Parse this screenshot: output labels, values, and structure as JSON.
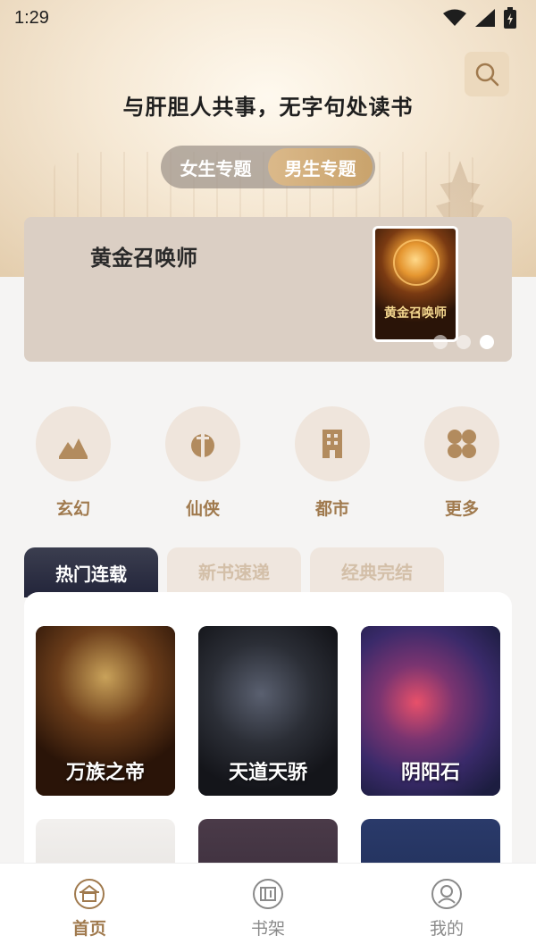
{
  "status_bar": {
    "time": "1:29"
  },
  "header": {
    "slogan": "与肝胆人共事，无字句处读书"
  },
  "gender_tabs": [
    {
      "label": "女生专题",
      "active": false
    },
    {
      "label": "男生专题",
      "active": true
    }
  ],
  "banner": {
    "title": "黄金召唤师",
    "cover_text": "黄金召唤师",
    "dots": 3,
    "active_dot": 3
  },
  "categories": [
    {
      "label": "玄幻",
      "icon": "mountain-icon"
    },
    {
      "label": "仙侠",
      "icon": "sword-icon"
    },
    {
      "label": "都市",
      "icon": "building-icon"
    },
    {
      "label": "更多",
      "icon": "grid-icon"
    }
  ],
  "list_tabs": [
    {
      "label": "热门连载",
      "active": true
    },
    {
      "label": "新书速递",
      "active": false
    },
    {
      "label": "经典完结",
      "active": false
    }
  ],
  "books": [
    {
      "title": "万族之帝"
    },
    {
      "title": "天道天骄"
    },
    {
      "title": "阴阳石"
    },
    {
      "title": ""
    },
    {
      "title": ""
    },
    {
      "title": ""
    }
  ],
  "bottom_nav": [
    {
      "label": "首页",
      "active": true,
      "icon": "home-icon"
    },
    {
      "label": "书架",
      "active": false,
      "icon": "bookshelf-icon"
    },
    {
      "label": "我的",
      "active": false,
      "icon": "profile-icon"
    }
  ],
  "colors": {
    "accent": "#a07a4e",
    "tab_dark": "#2b2d41",
    "banner_bg": "#dbcfc4"
  }
}
